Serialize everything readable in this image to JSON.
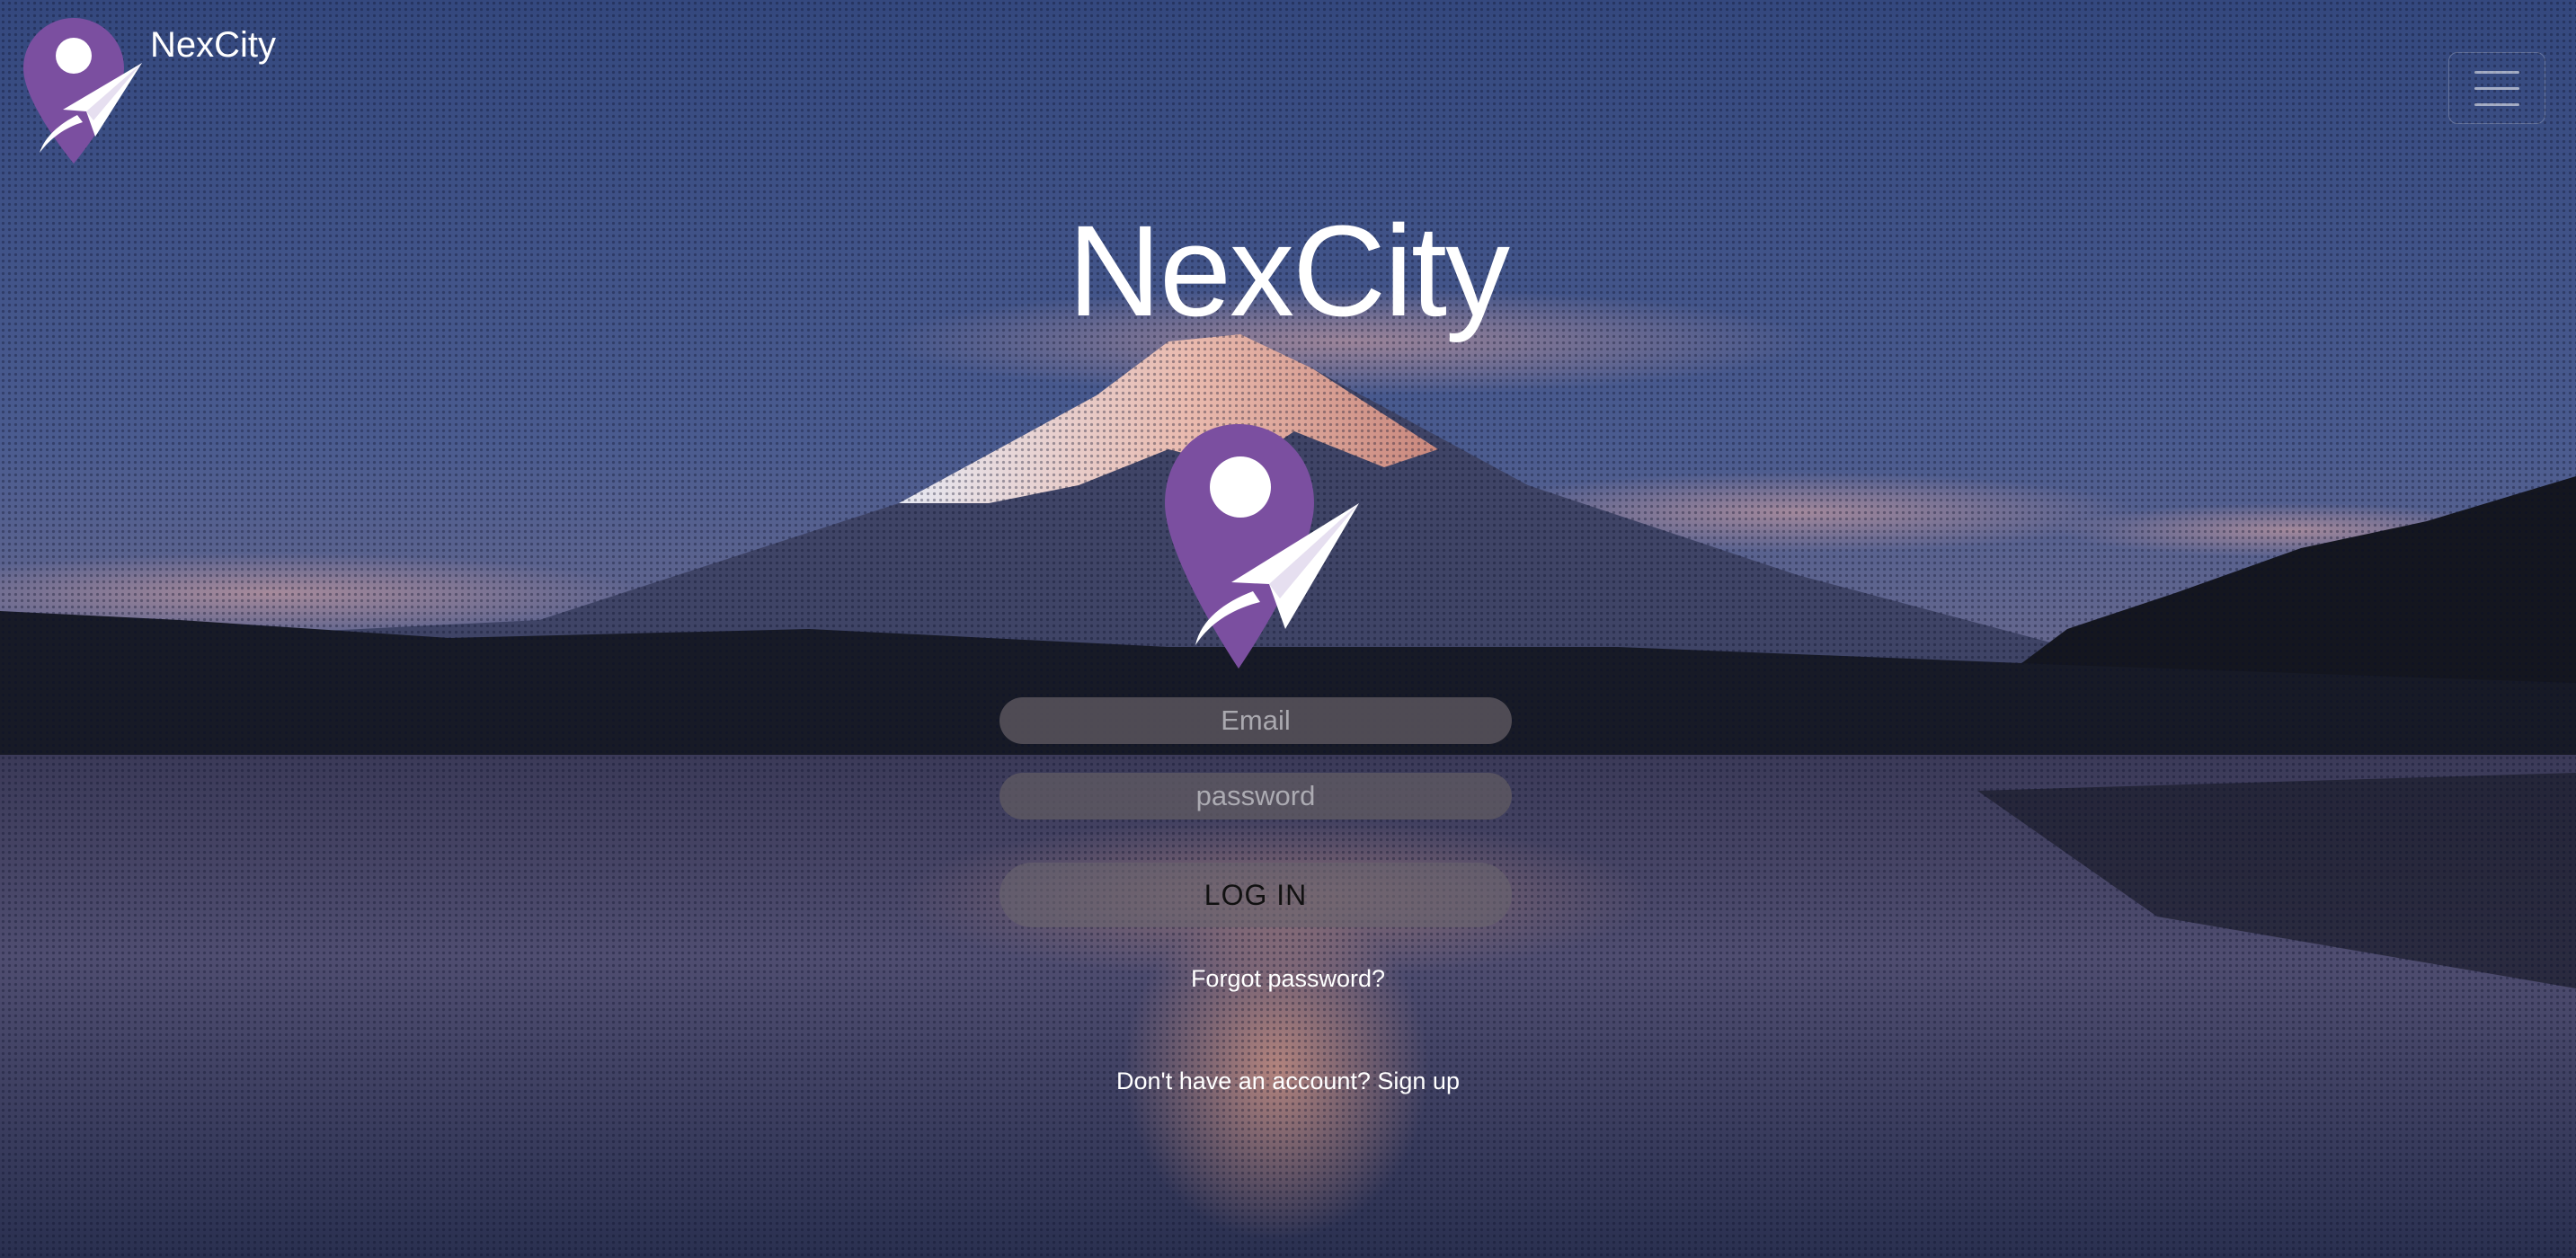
{
  "colors": {
    "brand_purple": "#7b4fa0",
    "text_white": "#ffffff",
    "field_bg": "#5f5a62",
    "login_text": "#111111"
  },
  "navbar": {
    "brand": "NexCity",
    "logo_icon": "location-pin-paper-plane-icon",
    "menu_icon": "hamburger-menu-icon"
  },
  "hero": {
    "title": "NexCity",
    "logo_icon": "location-pin-paper-plane-icon"
  },
  "login_form": {
    "email_placeholder": "Email",
    "email_value": "",
    "password_placeholder": "password",
    "password_value": "",
    "login_label": "LOG IN",
    "forgot_password": "Forgot password?",
    "signup_text": "Don't have an account? Sign up"
  }
}
